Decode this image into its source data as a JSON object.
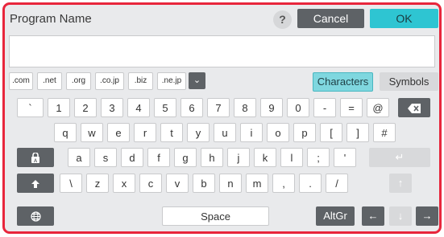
{
  "header": {
    "title": "Program Name",
    "help_icon": "?",
    "cancel_label": "Cancel",
    "ok_label": "OK"
  },
  "input": {
    "value": ""
  },
  "domains": [
    ".com",
    ".net",
    ".org",
    ".co.jp",
    ".biz",
    ".ne.jp"
  ],
  "mode_tabs": {
    "characters": "Characters",
    "symbols": "Symbols",
    "active": "Characters"
  },
  "rows": {
    "row1": [
      "`",
      "1",
      "2",
      "3",
      "4",
      "5",
      "6",
      "7",
      "8",
      "9",
      "0",
      "-",
      "=",
      "@"
    ],
    "row2": [
      "q",
      "w",
      "e",
      "r",
      "t",
      "y",
      "u",
      "i",
      "o",
      "p",
      "[",
      "]",
      "#"
    ],
    "row3": [
      "a",
      "s",
      "d",
      "f",
      "g",
      "h",
      "j",
      "k",
      "l",
      ";",
      "'"
    ],
    "row4": [
      "\\",
      "z",
      "x",
      "c",
      "v",
      "b",
      "n",
      "m",
      ",",
      ".",
      "/"
    ]
  },
  "bottom": {
    "space_label": "Space",
    "altgr_label": "AltGr"
  },
  "icons": {
    "backspace": "backspace-icon",
    "caps_lock": "caps-lock-icon",
    "shift": "shift-icon",
    "globe": "globe-icon",
    "arrow_left": "arrow-left-icon",
    "arrow_right": "arrow-right-icon",
    "arrow_up": "arrow-up-icon",
    "arrow_down": "arrow-down-icon",
    "dropdown": "chevron-down-icon"
  },
  "colors": {
    "frame": "#e8263c",
    "accent": "#2ec5d2",
    "dark_key": "#5e6266"
  }
}
